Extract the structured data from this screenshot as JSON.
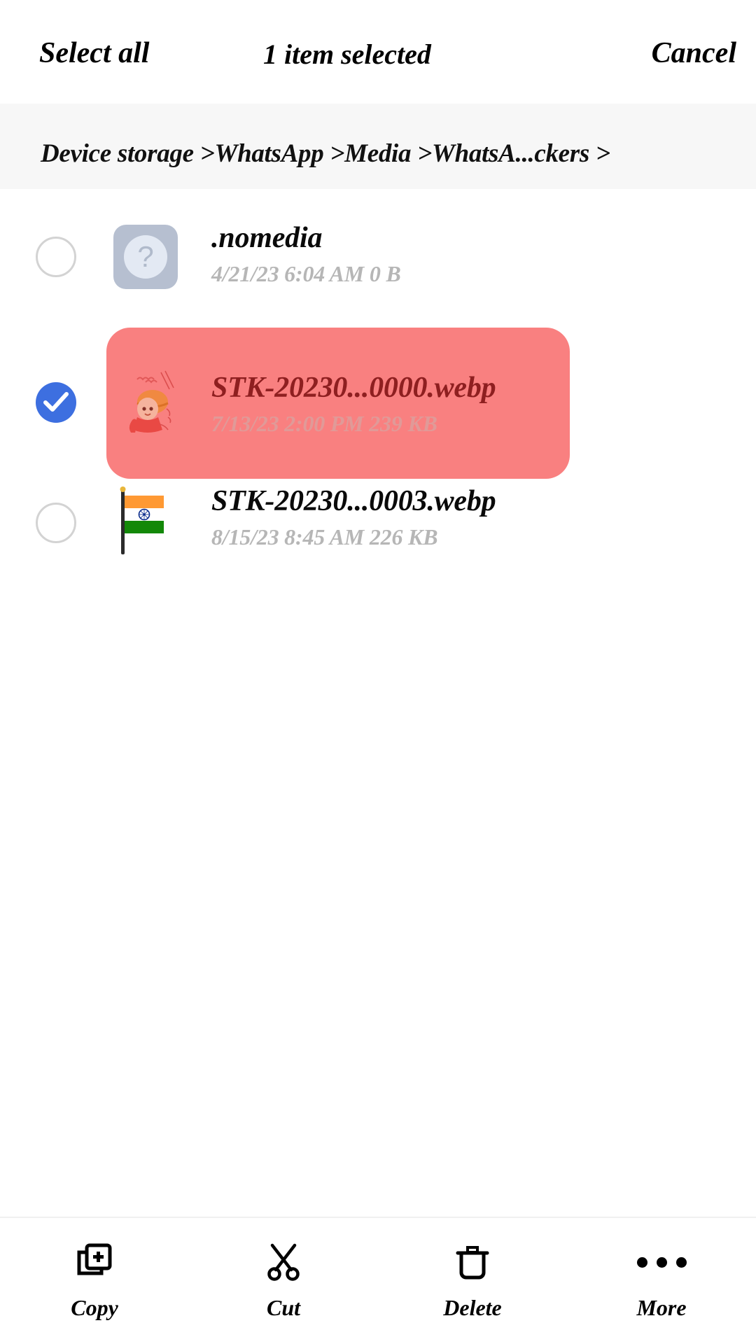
{
  "topbar": {
    "select_all_label": "Select all",
    "selection_count_label": "1 item selected",
    "cancel_label": "Cancel"
  },
  "breadcrumb": {
    "path_text": "Device storage >WhatsApp >Media >WhatsA...ckers >"
  },
  "files": [
    {
      "name": ".nomedia",
      "date": "4/21/23 6:04 AM",
      "size": "0 B",
      "meta": "4/21/23 6:04 AM   0 B",
      "selected": false,
      "thumbnail": "unknown-file-icon",
      "thumbnail_glyph": "?"
    },
    {
      "name": "STK-20230...0000.webp",
      "date": "7/13/23 2:00 PM",
      "size": "239 KB",
      "meta": "7/13/23 2:00 PM   239 KB",
      "selected": true,
      "thumbnail": "sticker-thumbnail"
    },
    {
      "name": "STK-20230...0003.webp",
      "date": "8/15/23 8:45 AM",
      "size": "226 KB",
      "meta": "8/15/23 8:45 AM   226 KB",
      "selected": false,
      "thumbnail": "india-flag-thumbnail"
    }
  ],
  "bottombar": {
    "actions": [
      {
        "label": "Copy",
        "icon": "copy-icon"
      },
      {
        "label": "Cut",
        "icon": "scissors-icon"
      },
      {
        "label": "Delete",
        "icon": "trash-icon"
      },
      {
        "label": "More",
        "icon": "more-dots-icon"
      }
    ]
  },
  "colors": {
    "selection_highlight": "#f98080",
    "checkbox_checked": "#3d6fe0",
    "checkbox_unchecked_ring": "#d3d3d3",
    "breadcrumb_background": "#f7f7f7",
    "meta_text": "#b6b6b6",
    "selected_name_text": "#8e1f20"
  }
}
